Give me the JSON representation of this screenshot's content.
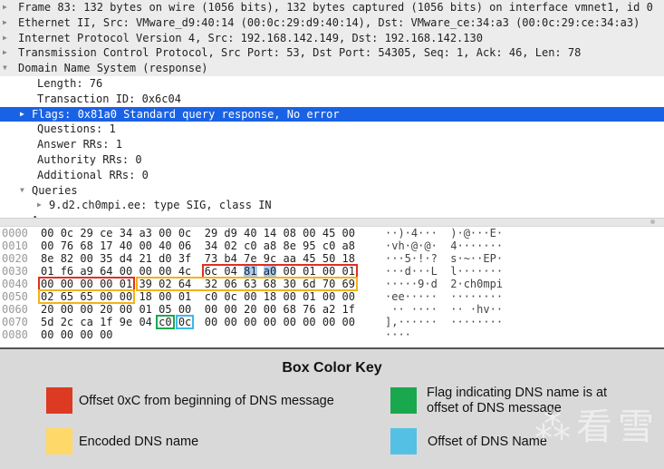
{
  "tree": [
    {
      "text": "Frame 83: 132 bytes on wire (1056 bits), 132 bytes captured (1056 bits) on interface vmnet1, id 0",
      "indent": 0,
      "arrow": "collapsed",
      "style": "top"
    },
    {
      "text": "Ethernet II, Src: VMware_d9:40:14 (00:0c:29:d9:40:14), Dst: VMware_ce:34:a3 (00:0c:29:ce:34:a3)",
      "indent": 0,
      "arrow": "collapsed",
      "style": "top"
    },
    {
      "text": "Internet Protocol Version 4, Src: 192.168.142.149, Dst: 192.168.142.130",
      "indent": 0,
      "arrow": "collapsed",
      "style": "top"
    },
    {
      "text": "Transmission Control Protocol, Src Port: 53, Dst Port: 54305, Seq: 1, Ack: 46, Len: 78",
      "indent": 0,
      "arrow": "collapsed",
      "style": "top"
    },
    {
      "text": "Domain Name System (response)",
      "indent": 0,
      "arrow": "expanded",
      "style": "top"
    },
    {
      "text": "Length: 76",
      "indent": 2,
      "arrow": "none",
      "style": ""
    },
    {
      "text": "Transaction ID: 0x6c04",
      "indent": 2,
      "arrow": "none",
      "style": ""
    },
    {
      "text": "Flags: 0x81a0 Standard query response, No error",
      "indent": 1,
      "arrow": "collapsed",
      "style": "sel"
    },
    {
      "text": "Questions: 1",
      "indent": 2,
      "arrow": "none",
      "style": ""
    },
    {
      "text": "Answer RRs: 1",
      "indent": 2,
      "arrow": "none",
      "style": ""
    },
    {
      "text": "Authority RRs: 0",
      "indent": 2,
      "arrow": "none",
      "style": ""
    },
    {
      "text": "Additional RRs: 0",
      "indent": 2,
      "arrow": "none",
      "style": ""
    },
    {
      "text": "Queries",
      "indent": 1,
      "arrow": "expanded",
      "style": ""
    },
    {
      "text": "9.d2.ch0mpi.ee: type SIG, class IN",
      "indent": 2,
      "arrow": "collapsed",
      "style": ""
    },
    {
      "text": "Answers",
      "indent": 1,
      "arrow": "expanded",
      "style": ""
    }
  ],
  "hex": [
    {
      "offset": "0000",
      "bytes": [
        "00",
        "0c",
        "29",
        "ce",
        "34",
        "a3",
        "00",
        "0c",
        "29",
        "d9",
        "40",
        "14",
        "08",
        "00",
        "45",
        "00"
      ],
      "ascii": "··)·4···  )·@···E·"
    },
    {
      "offset": "0010",
      "bytes": [
        "00",
        "76",
        "68",
        "17",
        "40",
        "00",
        "40",
        "06",
        "34",
        "02",
        "c0",
        "a8",
        "8e",
        "95",
        "c0",
        "a8"
      ],
      "ascii": "·vh·@·@·  4·······"
    },
    {
      "offset": "0020",
      "bytes": [
        "8e",
        "82",
        "00",
        "35",
        "d4",
        "21",
        "d0",
        "3f",
        "73",
        "b4",
        "7e",
        "9c",
        "aa",
        "45",
        "50",
        "18"
      ],
      "ascii": "···5·!·?  s·~··EP·"
    },
    {
      "offset": "0030",
      "bytes": [
        "01",
        "f6",
        "a9",
        "64",
        "00",
        "00",
        "00",
        "4c",
        "6c",
        "04",
        "81",
        "a0",
        "00",
        "01",
        "00",
        "01"
      ],
      "ascii": "···d···L  l·······"
    },
    {
      "offset": "0040",
      "bytes": [
        "00",
        "00",
        "00",
        "00",
        "01",
        "39",
        "02",
        "64",
        "32",
        "06",
        "63",
        "68",
        "30",
        "6d",
        "70",
        "69"
      ],
      "ascii": "·····9·d  2·ch0mpi"
    },
    {
      "offset": "0050",
      "bytes": [
        "02",
        "65",
        "65",
        "00",
        "00",
        "18",
        "00",
        "01",
        "c0",
        "0c",
        "00",
        "18",
        "00",
        "01",
        "00",
        "00"
      ],
      "ascii": "·ee·····  ········"
    },
    {
      "offset": "0060",
      "bytes": [
        "20",
        "00",
        "00",
        "20",
        "00",
        "01",
        "05",
        "00",
        "00",
        "00",
        "20",
        "00",
        "68",
        "76",
        "a2",
        "1f"
      ],
      "ascii": " ·· ····  ·· ·hv··"
    },
    {
      "offset": "0070",
      "bytes": [
        "5d",
        "2c",
        "ca",
        "1f",
        "9e",
        "04",
        "c0",
        "0c",
        "00",
        "00",
        "00",
        "00",
        "00",
        "00",
        "00",
        "00"
      ],
      "ascii": "],······  ········"
    },
    {
      "offset": "0080",
      "bytes": [
        "00",
        "00",
        "00",
        "00"
      ],
      "ascii": "····"
    }
  ],
  "highlighted_bytes": [
    {
      "row": 3,
      "from": 10,
      "to": 11
    }
  ],
  "boxes": [
    {
      "color": "#e0301e",
      "row": 3,
      "from": 8,
      "to": 15
    },
    {
      "color": "#e0301e",
      "row": 4,
      "from": 0,
      "to": 4
    },
    {
      "color": "#f2b21b",
      "row": 4,
      "from": 5,
      "to": 15
    },
    {
      "color": "#f2b21b",
      "row": 5,
      "from": 0,
      "to": 4
    },
    {
      "color": "#1aa84f",
      "row": 7,
      "from": 6,
      "to": 6
    },
    {
      "color": "#3db8e6",
      "row": 7,
      "from": 7,
      "to": 7
    }
  ],
  "legend": {
    "title": "Box Color Key",
    "items": [
      {
        "color": "#dc3a22",
        "label": "Offset 0xC from beginning of DNS message"
      },
      {
        "color": "#1aa84f",
        "label": "Flag indicating DNS name is at offset of DNS message"
      },
      {
        "color": "#fed868",
        "label": "Encoded DNS name"
      },
      {
        "color": "#54c1e4",
        "label": "Offset of DNS Name"
      }
    ]
  },
  "watermark": "看雪"
}
